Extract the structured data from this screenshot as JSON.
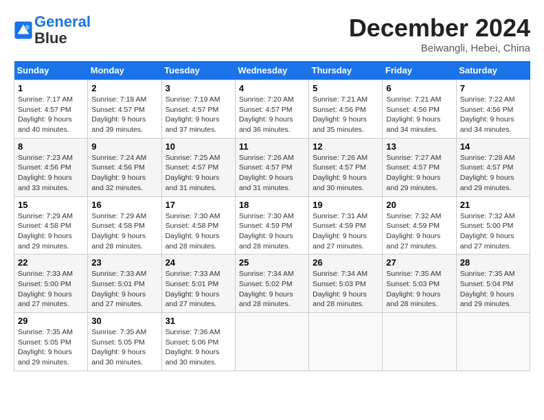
{
  "logo": {
    "line1": "General",
    "line2": "Blue"
  },
  "title": "December 2024",
  "location": "Beiwangli, Hebei, China",
  "weekdays": [
    "Sunday",
    "Monday",
    "Tuesday",
    "Wednesday",
    "Thursday",
    "Friday",
    "Saturday"
  ],
  "weeks": [
    [
      {
        "day": 1,
        "sunrise": "7:17 AM",
        "sunset": "4:57 PM",
        "daylight": "9 hours and 40 minutes."
      },
      {
        "day": 2,
        "sunrise": "7:18 AM",
        "sunset": "4:57 PM",
        "daylight": "9 hours and 39 minutes."
      },
      {
        "day": 3,
        "sunrise": "7:19 AM",
        "sunset": "4:57 PM",
        "daylight": "9 hours and 37 minutes."
      },
      {
        "day": 4,
        "sunrise": "7:20 AM",
        "sunset": "4:57 PM",
        "daylight": "9 hours and 36 minutes."
      },
      {
        "day": 5,
        "sunrise": "7:21 AM",
        "sunset": "4:56 PM",
        "daylight": "9 hours and 35 minutes."
      },
      {
        "day": 6,
        "sunrise": "7:21 AM",
        "sunset": "4:56 PM",
        "daylight": "9 hours and 34 minutes."
      },
      {
        "day": 7,
        "sunrise": "7:22 AM",
        "sunset": "4:56 PM",
        "daylight": "9 hours and 34 minutes."
      }
    ],
    [
      {
        "day": 8,
        "sunrise": "7:23 AM",
        "sunset": "4:56 PM",
        "daylight": "9 hours and 33 minutes."
      },
      {
        "day": 9,
        "sunrise": "7:24 AM",
        "sunset": "4:56 PM",
        "daylight": "9 hours and 32 minutes."
      },
      {
        "day": 10,
        "sunrise": "7:25 AM",
        "sunset": "4:57 PM",
        "daylight": "9 hours and 31 minutes."
      },
      {
        "day": 11,
        "sunrise": "7:26 AM",
        "sunset": "4:57 PM",
        "daylight": "9 hours and 31 minutes."
      },
      {
        "day": 12,
        "sunrise": "7:26 AM",
        "sunset": "4:57 PM",
        "daylight": "9 hours and 30 minutes."
      },
      {
        "day": 13,
        "sunrise": "7:27 AM",
        "sunset": "4:57 PM",
        "daylight": "9 hours and 29 minutes."
      },
      {
        "day": 14,
        "sunrise": "7:28 AM",
        "sunset": "4:57 PM",
        "daylight": "9 hours and 29 minutes."
      }
    ],
    [
      {
        "day": 15,
        "sunrise": "7:29 AM",
        "sunset": "4:58 PM",
        "daylight": "9 hours and 29 minutes."
      },
      {
        "day": 16,
        "sunrise": "7:29 AM",
        "sunset": "4:58 PM",
        "daylight": "9 hours and 28 minutes."
      },
      {
        "day": 17,
        "sunrise": "7:30 AM",
        "sunset": "4:58 PM",
        "daylight": "9 hours and 28 minutes."
      },
      {
        "day": 18,
        "sunrise": "7:30 AM",
        "sunset": "4:59 PM",
        "daylight": "9 hours and 28 minutes."
      },
      {
        "day": 19,
        "sunrise": "7:31 AM",
        "sunset": "4:59 PM",
        "daylight": "9 hours and 27 minutes."
      },
      {
        "day": 20,
        "sunrise": "7:32 AM",
        "sunset": "4:59 PM",
        "daylight": "9 hours and 27 minutes."
      },
      {
        "day": 21,
        "sunrise": "7:32 AM",
        "sunset": "5:00 PM",
        "daylight": "9 hours and 27 minutes."
      }
    ],
    [
      {
        "day": 22,
        "sunrise": "7:33 AM",
        "sunset": "5:00 PM",
        "daylight": "9 hours and 27 minutes."
      },
      {
        "day": 23,
        "sunrise": "7:33 AM",
        "sunset": "5:01 PM",
        "daylight": "9 hours and 27 minutes."
      },
      {
        "day": 24,
        "sunrise": "7:33 AM",
        "sunset": "5:01 PM",
        "daylight": "9 hours and 27 minutes."
      },
      {
        "day": 25,
        "sunrise": "7:34 AM",
        "sunset": "5:02 PM",
        "daylight": "9 hours and 28 minutes."
      },
      {
        "day": 26,
        "sunrise": "7:34 AM",
        "sunset": "5:03 PM",
        "daylight": "9 hours and 28 minutes."
      },
      {
        "day": 27,
        "sunrise": "7:35 AM",
        "sunset": "5:03 PM",
        "daylight": "9 hours and 28 minutes."
      },
      {
        "day": 28,
        "sunrise": "7:35 AM",
        "sunset": "5:04 PM",
        "daylight": "9 hours and 29 minutes."
      }
    ],
    [
      {
        "day": 29,
        "sunrise": "7:35 AM",
        "sunset": "5:05 PM",
        "daylight": "9 hours and 29 minutes."
      },
      {
        "day": 30,
        "sunrise": "7:35 AM",
        "sunset": "5:05 PM",
        "daylight": "9 hours and 30 minutes."
      },
      {
        "day": 31,
        "sunrise": "7:36 AM",
        "sunset": "5:06 PM",
        "daylight": "9 hours and 30 minutes."
      },
      null,
      null,
      null,
      null
    ]
  ]
}
